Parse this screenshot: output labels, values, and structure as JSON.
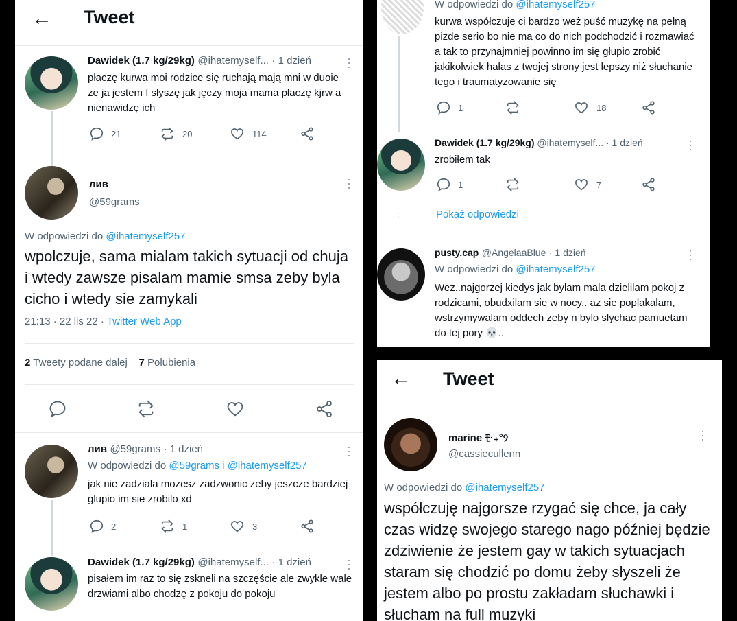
{
  "left": {
    "header": {
      "back_glyph": "←",
      "title": "Tweet"
    },
    "tweet1": {
      "name": "Dawidek (1.7 kg/29kg)",
      "handle": "@ihatemyself...",
      "time": "· 1 dzień",
      "text": "płaczę kurwa moi rodzice się ruchają mają mni w duoie ze ja jestem I słyszę jak jęczy moja mama płaczę kjrw a nienawidzę ich",
      "replies": "21",
      "retweets": "20",
      "likes": "114"
    },
    "main": {
      "name": "лив",
      "handle": "@59grams",
      "reply_to_label": "W odpowiedzi do",
      "reply_to": "@ihatemyself257",
      "text": "wpolczuje, sama mialam takich sytuacji od chuja i wtedy zawsze pisalam mamie smsa zeby byla cicho i wtedy sie zamykali",
      "timestamp": "21:13 · 22 lis 22 ·",
      "source": "Twitter Web App",
      "retweet_count": "2",
      "retweet_label": "Tweety podane dalej",
      "like_count": "7",
      "like_label": "Polubienia"
    },
    "reply1": {
      "name": "лив",
      "handle": "@59grams",
      "time": "· 1 dzień",
      "reply_to_label": "W odpowiedzi do",
      "reply_to": "@59grams i @ihatemyself257",
      "text": "jak nie zadziala mozesz zadzwonic zeby jeszcze bardziej glupio im sie zrobilo xd",
      "replies": "2",
      "retweets": "1",
      "likes": "3"
    },
    "reply2": {
      "name": "Dawidek (1.7 kg/29kg)",
      "handle": "@ihatemyself...",
      "time": "· 1 dzień",
      "text": "pisałem im raz to się zskneli na szczęście ale zwykle wale drzwiami albo chodzę z pokoju do pokoju"
    }
  },
  "topright": {
    "reply_to_label": "W odpowiedzi do",
    "reply_to": "@ihatemyself257",
    "text": "kurwa współczuje ci bardzo weż puść muzykę na pełną pizde serio bo nie ma co do nich podchodzić i rozmawiać a tak to przynajmniej powinno im się głupio zrobić jakikolwiek hałas z twojej strony jest lepszy niż słuchanie tego i traumatyzowanie się",
    "replies": "1",
    "retweets": "",
    "likes": "18",
    "dawidek": {
      "name": "Dawidek (1.7 kg/29kg)",
      "handle": "@ihatemyself...",
      "time": "· 1 dzień",
      "text": "zrobiłem tak",
      "replies": "1",
      "likes": "7"
    },
    "show_replies": "Pokaż odpowiedzi",
    "pusty": {
      "name": "pusty.cap",
      "handle": "@AngelaaBlue",
      "time": "· 1 dzień",
      "reply_to_label": "W odpowiedzi do",
      "reply_to": "@ihatemyself257",
      "text": "Wez..najgorzej kiedys jak bylam mala dzielilam pokoj z rodzicami, obudxilam sie w nocy.. az sie poplakalam, wstrzymywalam oddech zeby n bylo slychac pamuetam do tej pory 💀.."
    }
  },
  "bottomright": {
    "header": {
      "back_glyph": "←",
      "title": "Tweet"
    },
    "name": "marine ﾓ·₊°୨",
    "handle": "@cassiecullenn",
    "reply_to_label": "W odpowiedzi do",
    "reply_to": "@ihatemyself257",
    "text": "współczuję najgorsze rzygać się chce, ja cały czas widzę swojego starego nago później będzie zdziwienie że jestem gay w takich sytuacjach staram się chodzić po domu żeby słyszeli że jestem albo po prostu zakładam słuchawki i słucham na full muzyki"
  },
  "colors": {
    "link": "#1d9bf0",
    "muted": "#536471",
    "text": "#0f1419",
    "divider": "#e6e9ec"
  },
  "icons": [
    "back-arrow-icon",
    "reply-icon",
    "retweet-icon",
    "like-icon",
    "share-icon",
    "more-icon"
  ]
}
